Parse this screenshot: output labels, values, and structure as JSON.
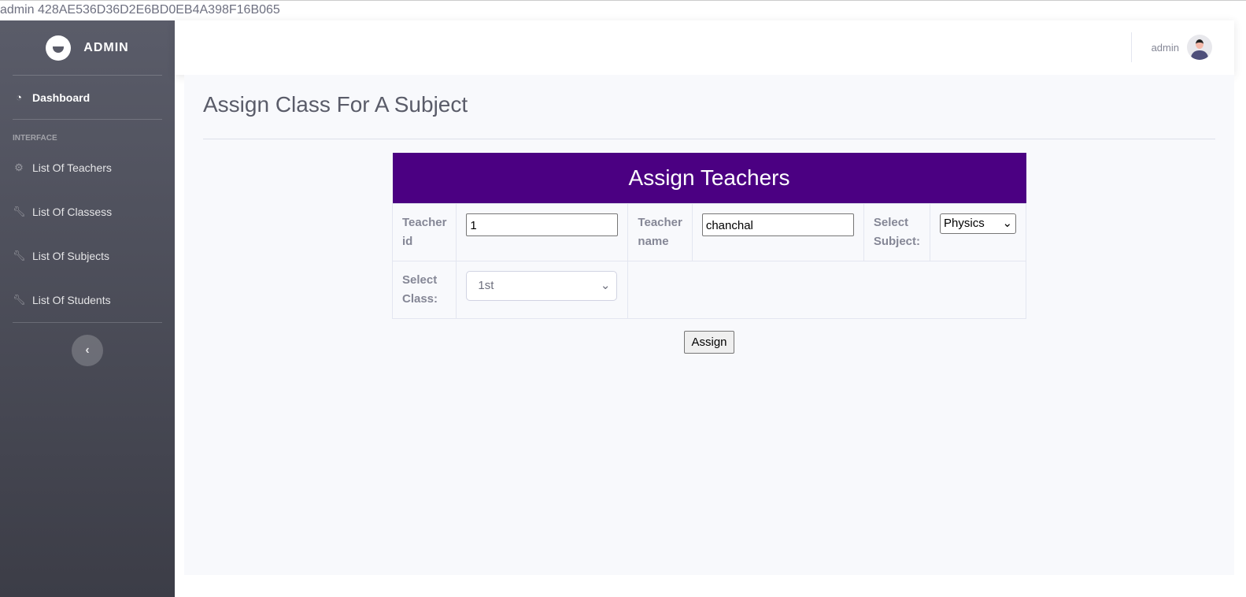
{
  "top_strip": {
    "text": "admin 428AE536D36D2E6BD0EB4A398F16B065"
  },
  "sidebar": {
    "brand": "ADMIN",
    "dashboard": "Dashboard",
    "heading": "INTERFACE",
    "items": [
      {
        "label": "List Of Teachers",
        "icon": "gear-icon"
      },
      {
        "label": "List Of Classess",
        "icon": "wrench-icon"
      },
      {
        "label": "List Of Subjects",
        "icon": "wrench-icon"
      },
      {
        "label": "List Of Students",
        "icon": "wrench-icon"
      }
    ],
    "toggle": "‹"
  },
  "topbar": {
    "username": "admin"
  },
  "main": {
    "title": "Assign Class For A Subject",
    "form": {
      "header": "Assign Teachers",
      "teacher_id_label": "Teacher id",
      "teacher_id_value": "1",
      "teacher_name_label": "Teacher name",
      "teacher_name_value": "chanchal",
      "subject_label": "Select Subject:",
      "subject_value": "Physics",
      "class_label": "Select Class:",
      "class_value": "1st",
      "submit": "Assign"
    }
  },
  "colors": {
    "header": "#4b0082",
    "sidebar": "#5a5c69"
  }
}
